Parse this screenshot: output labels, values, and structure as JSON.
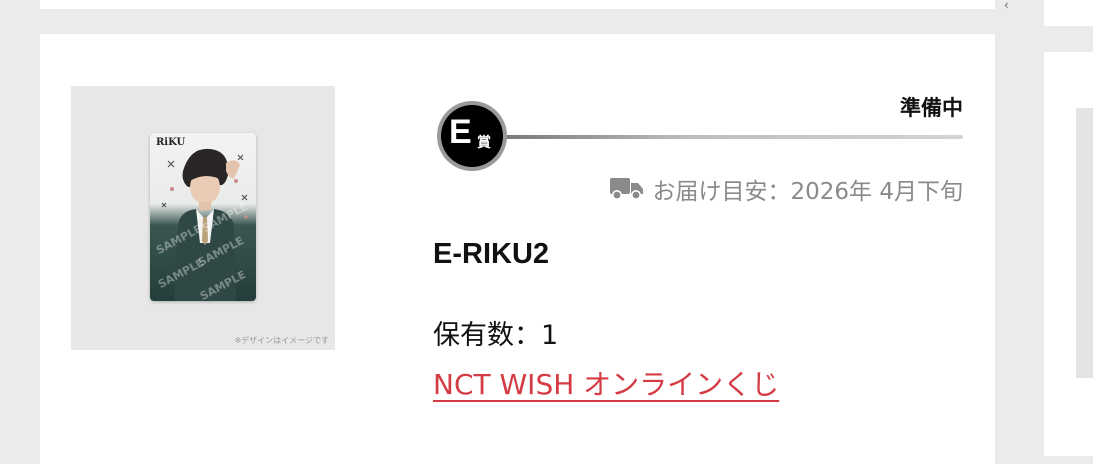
{
  "item": {
    "prize_letter": "E",
    "prize_suffix": "賞",
    "status": "準備中",
    "delivery_text": "お届け目安：2026年 4月下旬",
    "name": "E-RIKU2",
    "quantity_text": "保有数：1",
    "link_text": "NCT WISH オンラインくじ",
    "image_caption": "※デザインはイメージです",
    "image_logo": "RiKU",
    "sample_watermark": "SAMPLE"
  },
  "colors": {
    "link": "#d43b44",
    "page_background": "#ebebeb",
    "card_background": "#ffffff",
    "muted_text": "#8a8a8a"
  },
  "icons": {
    "delivery": "truck-icon",
    "prize": "prize-badge-icon"
  }
}
